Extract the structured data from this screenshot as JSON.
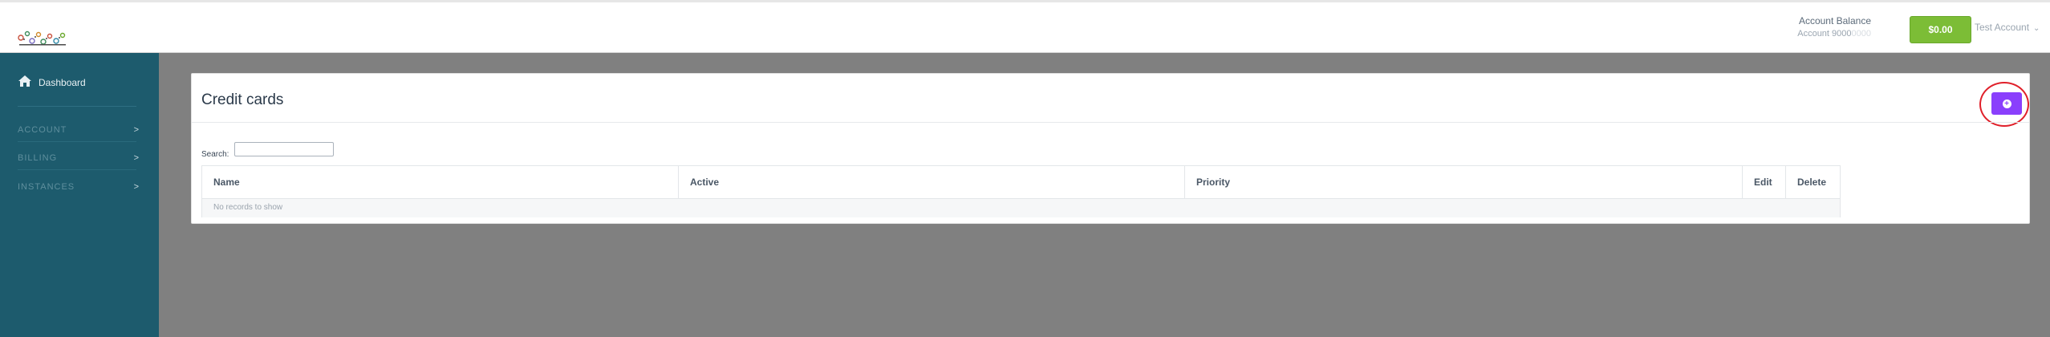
{
  "header": {
    "account_balance_label": "Account Balance",
    "account_number_prefix": "Account 9000",
    "account_number_hidden": "0000",
    "balance": "$0.00",
    "user": "Test Account"
  },
  "sidebar": {
    "dashboard": "Dashboard",
    "items": [
      {
        "label": "ACCOUNT",
        "arrow": ">"
      },
      {
        "label": "BILLING",
        "arrow": ">"
      },
      {
        "label": "INSTANCES",
        "arrow": ">"
      }
    ]
  },
  "main": {
    "title": "Credit cards",
    "add_button_icon": "plus-circle-icon",
    "search_label": "Search:",
    "search_value": "",
    "columns": [
      "Name",
      "Active",
      "Priority",
      "Edit",
      "Delete"
    ],
    "empty_text": "No records to show"
  },
  "colors": {
    "sidebar": "#1d5b6d",
    "balance_button": "#7cbd36",
    "add_button": "#8a3ffc",
    "highlight": "#e0202a"
  }
}
